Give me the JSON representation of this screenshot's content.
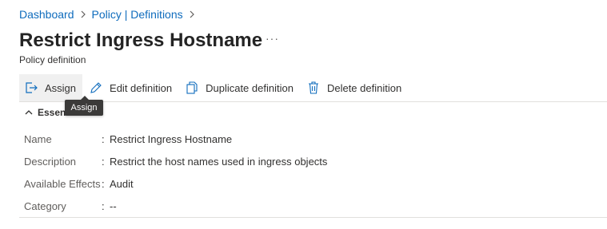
{
  "breadcrumb": {
    "items": [
      {
        "label": "Dashboard"
      },
      {
        "label": "Policy | Definitions"
      }
    ]
  },
  "header": {
    "title": "Restrict Ingress Hostname",
    "more_icon": "more-icon",
    "subtitle": "Policy definition"
  },
  "toolbar": {
    "assign_label": "Assign",
    "edit_label": "Edit definition",
    "duplicate_label": "Duplicate definition",
    "delete_label": "Delete definition"
  },
  "tooltip": {
    "text": "Assign"
  },
  "essentials": {
    "header": "Essentials",
    "properties": [
      {
        "key": "Name",
        "value": "Restrict Ingress Hostname"
      },
      {
        "key": "Description",
        "value": "Restrict the host names used in ingress objects"
      },
      {
        "key": "Available Effects",
        "value": "Audit"
      },
      {
        "key": "Category",
        "value": "--"
      }
    ]
  },
  "colors": {
    "link": "#0f6cbd",
    "text": "#323130",
    "label": "#605e5c",
    "tooltip_bg": "#3b3a39",
    "accent_icon": "#0f6cbd"
  }
}
